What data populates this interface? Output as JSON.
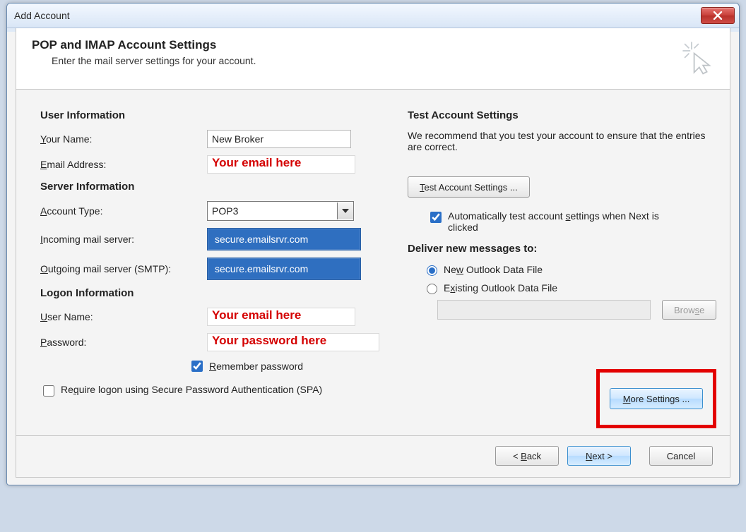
{
  "window": {
    "title": "Add Account"
  },
  "header": {
    "title": "POP and IMAP Account Settings",
    "subtitle": "Enter the mail server settings for your account."
  },
  "left": {
    "sections": {
      "user": "User Information",
      "server": "Server Information",
      "logon": "Logon Information"
    },
    "labels": {
      "your_name": "Your Name:",
      "email": "Email Address:",
      "account_type": "Account Type:",
      "incoming": "Incoming mail server:",
      "outgoing": "Outgoing mail server (SMTP):",
      "username": "User Name:",
      "password": "Password:"
    },
    "values": {
      "your_name": "New Broker",
      "email_hint": "Your email here",
      "account_type": "POP3",
      "incoming": "secure.emailsrvr.com",
      "outgoing": "secure.emailsrvr.com",
      "username_hint": "Your email here",
      "password_hint": "Your password here"
    },
    "remember_label": "Remember password",
    "spa_label": "Require logon using Secure Password Authentication (SPA)"
  },
  "right": {
    "title": "Test Account Settings",
    "desc": "We recommend that you test your account to ensure that the entries are correct.",
    "test_btn": "Test Account Settings ...",
    "auto_test": "Automatically test account settings when Next is clicked",
    "deliver_title": "Deliver new messages to:",
    "radio_new": "New Outlook Data File",
    "radio_existing": "Existing Outlook Data File",
    "browse_btn": "Browse",
    "more_btn": "More Settings ..."
  },
  "footer": {
    "back": "< Back",
    "next": "Next >",
    "cancel": "Cancel"
  }
}
